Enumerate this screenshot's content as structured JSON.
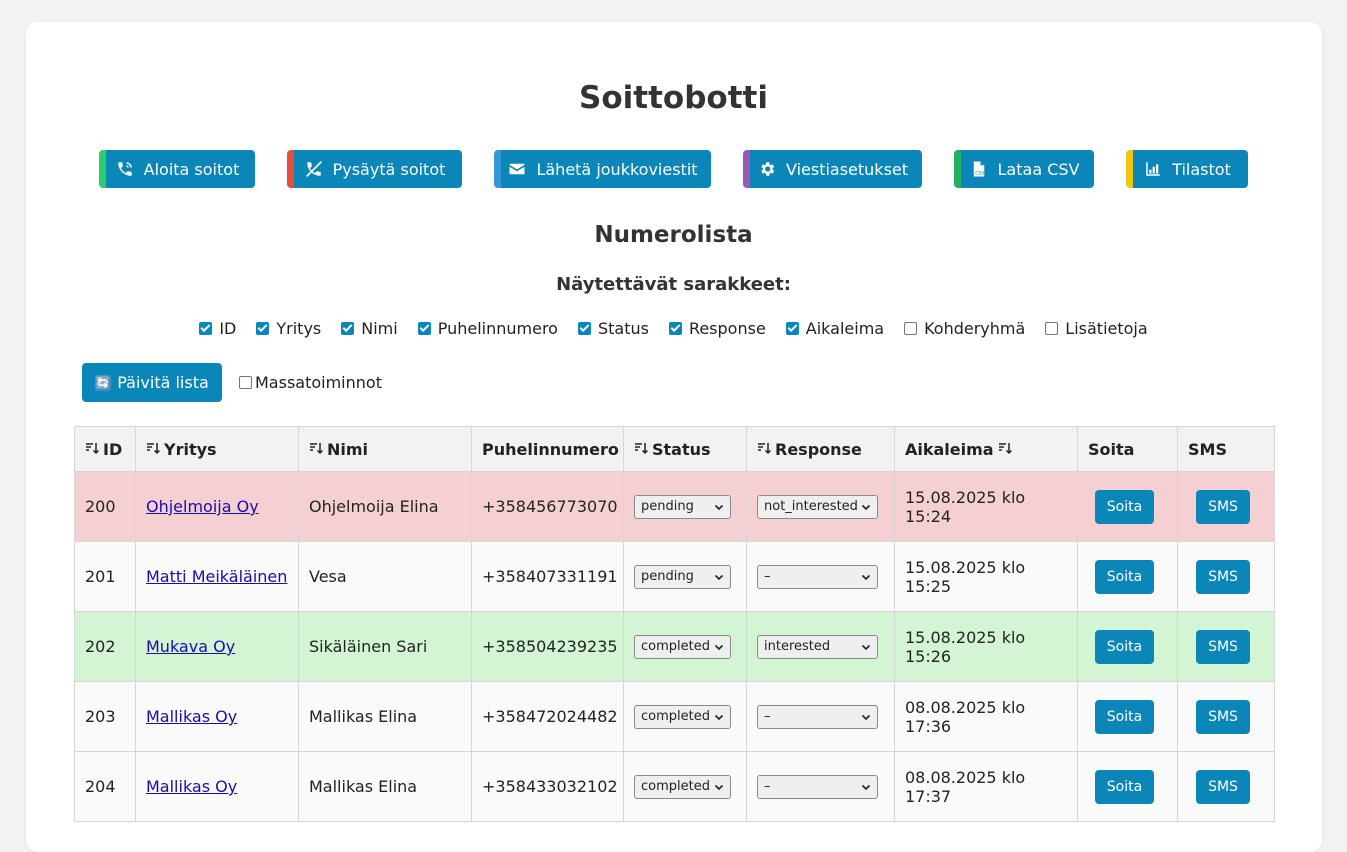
{
  "title": "Soittobotti",
  "toolbar": {
    "buttons": [
      {
        "label": "Aloita soitot",
        "icon": "phone-call-icon",
        "accent": "#2ecc71"
      },
      {
        "label": "Pysäytä soitot",
        "icon": "phone-slash-icon",
        "accent": "#e74c3c"
      },
      {
        "label": "Lähetä joukkoviestit",
        "icon": "envelope-icon",
        "accent": "#3498db"
      },
      {
        "label": "Viestiasetukset",
        "icon": "gear-icon",
        "accent": "#9b59b6"
      },
      {
        "label": "Lataa CSV",
        "icon": "csv-file-icon",
        "accent": "#27ae60"
      },
      {
        "label": "Tilastot",
        "icon": "chart-icon",
        "accent": "#f1c40f"
      }
    ]
  },
  "section_title": "Numerolista",
  "columns_title": "Näytettävät sarakkeet:",
  "column_options": [
    {
      "label": "ID",
      "checked": true
    },
    {
      "label": "Yritys",
      "checked": true
    },
    {
      "label": "Nimi",
      "checked": true
    },
    {
      "label": "Puhelinnumero",
      "checked": true
    },
    {
      "label": "Status",
      "checked": true
    },
    {
      "label": "Response",
      "checked": true
    },
    {
      "label": "Aikaleima",
      "checked": true
    },
    {
      "label": "Kohderyhmä",
      "checked": false
    },
    {
      "label": "Lisätietoja",
      "checked": false
    }
  ],
  "refresh_label": "Päivitä lista",
  "mass_label": "Massatoiminnot",
  "table": {
    "headers": [
      "ID",
      "Yritys",
      "Nimi",
      "Puhelinnumero",
      "Status",
      "Response",
      "Aikaleima",
      "Soita",
      "SMS"
    ],
    "call_label": "Soita",
    "sms_label": "SMS",
    "rows": [
      {
        "id": "200",
        "company": "Ohjelmoija Oy",
        "name": "Ohjelmoija Elina",
        "phone": "+358456773070",
        "status": "pending",
        "response": "not_interested",
        "timestamp": "15.08.2025 klo 15:24",
        "highlight": "pink"
      },
      {
        "id": "201",
        "company": "Matti Meikäläinen",
        "name": "Vesa",
        "phone": "+358407331191",
        "status": "pending",
        "response": "–",
        "timestamp": "15.08.2025 klo 15:25",
        "highlight": "plain"
      },
      {
        "id": "202",
        "company": "Mukava Oy",
        "name": "Sikäläinen Sari",
        "phone": "+358504239235",
        "status": "completed",
        "response": "interested",
        "timestamp": "15.08.2025 klo 15:26",
        "highlight": "green"
      },
      {
        "id": "203",
        "company": "Mallikas Oy",
        "name": "Mallikas Elina",
        "phone": "+358472024482",
        "status": "completed",
        "response": "–",
        "timestamp": "08.08.2025 klo 17:36",
        "highlight": "plain"
      },
      {
        "id": "204",
        "company": "Mallikas Oy",
        "name": "Mallikas Elina",
        "phone": "+358433032102",
        "status": "completed",
        "response": "–",
        "timestamp": "08.08.2025 klo 17:37",
        "highlight": "plain"
      }
    ]
  },
  "colors": {
    "primary": "#0a87b8",
    "pink_row": "#f5d0d2",
    "green_row": "#d3f5d3"
  }
}
